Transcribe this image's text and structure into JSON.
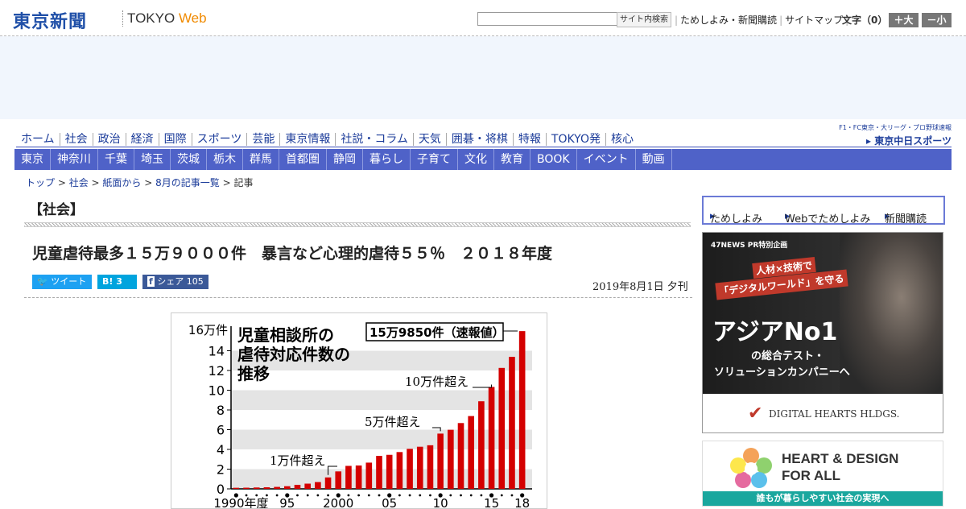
{
  "header": {
    "logo": "東京新聞",
    "logo_web_a": "TOKYO ",
    "logo_web_b": "Web",
    "search_button": "サイト内検索",
    "links": [
      "ためしよみ・新聞購読",
      "サイトマップ"
    ],
    "moji": "文字（0）",
    "zoom_in": "＋大",
    "zoom_out": "－小"
  },
  "nav_primary": [
    "ホーム",
    "社会",
    "政治",
    "経済",
    "国際",
    "スポーツ",
    "芸能",
    "東京情報",
    "社説・コラム",
    "天気",
    "囲碁・将棋",
    "特報",
    "TOKYO発",
    "核心"
  ],
  "chunichi": {
    "tagline": "F1・FC東京・大リーグ・プロ野球速報",
    "brand": "東京中日スポーツ"
  },
  "nav_region": [
    "東京",
    "神奈川",
    "千葉",
    "埼玉",
    "茨城",
    "栃木",
    "群馬",
    "首都圏",
    "静岡",
    "暮らし",
    "子育て",
    "文化",
    "教育",
    "BOOK",
    "イベント",
    "動画"
  ],
  "breadcrumb": [
    "トップ",
    "社会",
    "紙面から",
    "8月の記事一覧",
    "記事"
  ],
  "category": "【社会】",
  "headline": "児童虐待最多１５万９０００件　暴言など心理的虐待５５％　２０１８年度",
  "share": {
    "tweet": "ツイート",
    "hatena": "B! 3",
    "facebook": "シェア 105"
  },
  "date": "2019年8月1日 夕刊",
  "chart_data": {
    "type": "bar",
    "title": "児童相談所の虐待対応件数の推移",
    "callout": "15万9850件（速報値）",
    "ylabel": "16万件",
    "ylim": [
      0,
      16
    ],
    "yticks": [
      0,
      2,
      4,
      6,
      8,
      10,
      12,
      14
    ],
    "xlabels": [
      "1990年度",
      "95",
      "2000",
      "05",
      "10",
      "15",
      "18"
    ],
    "annotations": [
      {
        "text": "1万件超え",
        "year": 1999
      },
      {
        "text": "5万件超え",
        "year": 2010
      },
      {
        "text": "10万件超え",
        "year": 2015
      }
    ],
    "x": [
      1990,
      1991,
      1992,
      1993,
      1994,
      1995,
      1996,
      1997,
      1998,
      1999,
      2000,
      2001,
      2002,
      2003,
      2004,
      2005,
      2006,
      2007,
      2008,
      2009,
      2010,
      2011,
      2012,
      2013,
      2014,
      2015,
      2016,
      2017,
      2018
    ],
    "values": [
      0.11,
      0.12,
      0.14,
      0.16,
      0.2,
      0.27,
      0.41,
      0.53,
      0.69,
      1.16,
      1.77,
      2.33,
      2.37,
      2.66,
      3.34,
      3.45,
      3.73,
      4.06,
      4.27,
      4.42,
      5.6,
      5.99,
      6.67,
      7.38,
      8.88,
      10.33,
      12.26,
      13.38,
      15.99
    ]
  },
  "sidebar": {
    "links": [
      "ためしよみ",
      "Webでためしよみ",
      "新聞購読"
    ],
    "ad1": {
      "badge": "47NEWS PR特別企画",
      "line1": "人材×技術で",
      "line2": "「デジタルワールド」を守る",
      "big": "アジアNo1",
      "line3": "の総合テスト・",
      "line4": "ソリューションカンパニーへ",
      "company": "DIGITAL HEARTS HLDGS."
    },
    "ad2": {
      "line1": "HEART & DESIGN",
      "line2": "FOR ALL",
      "line3": "誰もが暮らしやすい社会の実現へ"
    }
  }
}
